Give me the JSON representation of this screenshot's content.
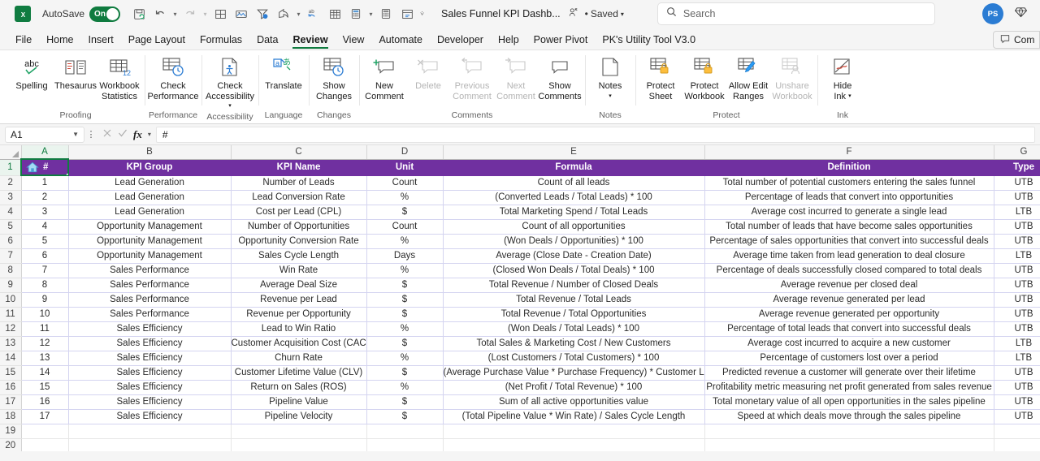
{
  "titlebar": {
    "app_logo": "excel-logo",
    "autosave_label": "AutoSave",
    "autosave_state": "On",
    "doc_title": "Sales Funnel KPI Dashb...",
    "saved_label": "Saved",
    "search_placeholder": "Search",
    "avatar_initials": "PS",
    "qat_icons": [
      "save-icon",
      "undo-icon",
      "redo-icon",
      "borders-icon",
      "picture-icon",
      "filter-icon",
      "share-icon",
      "sort-icon",
      "table-icon",
      "calculator-icon",
      "calculator2-icon",
      "form-icon",
      "more-icon"
    ]
  },
  "tabs": [
    {
      "label": "File",
      "active": false
    },
    {
      "label": "Home",
      "active": false
    },
    {
      "label": "Insert",
      "active": false
    },
    {
      "label": "Page Layout",
      "active": false
    },
    {
      "label": "Formulas",
      "active": false
    },
    {
      "label": "Data",
      "active": false
    },
    {
      "label": "Review",
      "active": true
    },
    {
      "label": "View",
      "active": false
    },
    {
      "label": "Automate",
      "active": false
    },
    {
      "label": "Developer",
      "active": false
    },
    {
      "label": "Help",
      "active": false
    },
    {
      "label": "Power Pivot",
      "active": false
    },
    {
      "label": "PK's Utility Tool V3.0",
      "active": false
    }
  ],
  "comments_button_label": "Com",
  "ribbon": {
    "groups": [
      {
        "name": "Proofing",
        "items": [
          {
            "label": "Spelling",
            "icon": "spelling-abc-icon",
            "disabled": false
          },
          {
            "label": "Thesaurus",
            "icon": "thesaurus-book-icon",
            "disabled": false
          },
          {
            "label": "Workbook\nStatistics",
            "icon": "workbook-statistics-icon",
            "disabled": false
          }
        ]
      },
      {
        "name": "Performance",
        "items": [
          {
            "label": "Check\nPerformance",
            "icon": "check-performance-icon",
            "disabled": false
          }
        ]
      },
      {
        "name": "Accessibility",
        "items": [
          {
            "label": "Check\nAccessibility",
            "icon": "check-accessibility-icon",
            "disabled": false,
            "caret": true
          }
        ]
      },
      {
        "name": "Language",
        "items": [
          {
            "label": "Translate",
            "icon": "translate-icon",
            "disabled": false
          }
        ]
      },
      {
        "name": "Changes",
        "items": [
          {
            "label": "Show\nChanges",
            "icon": "show-changes-icon",
            "disabled": false
          }
        ]
      },
      {
        "name": "Comments",
        "items": [
          {
            "label": "New\nComment",
            "icon": "new-comment-icon",
            "disabled": false
          },
          {
            "label": "Delete",
            "icon": "delete-comment-icon",
            "disabled": true
          },
          {
            "label": "Previous\nComment",
            "icon": "previous-comment-icon",
            "disabled": true
          },
          {
            "label": "Next\nComment",
            "icon": "next-comment-icon",
            "disabled": true
          },
          {
            "label": "Show\nComments",
            "icon": "show-comments-icon",
            "disabled": false
          }
        ]
      },
      {
        "name": "Notes",
        "items": [
          {
            "label": "Notes",
            "icon": "notes-icon",
            "disabled": false,
            "caret": true
          }
        ]
      },
      {
        "name": "Protect",
        "items": [
          {
            "label": "Protect\nSheet",
            "icon": "protect-sheet-icon",
            "disabled": false
          },
          {
            "label": "Protect\nWorkbook",
            "icon": "protect-workbook-icon",
            "disabled": false
          },
          {
            "label": "Allow Edit\nRanges",
            "icon": "allow-edit-ranges-icon",
            "disabled": false
          },
          {
            "label": "Unshare\nWorkbook",
            "icon": "unshare-workbook-icon",
            "disabled": true
          }
        ]
      },
      {
        "name": "Ink",
        "items": [
          {
            "label": "Hide\nInk",
            "icon": "hide-ink-icon",
            "disabled": false,
            "caret": true
          }
        ]
      }
    ]
  },
  "formula_bar": {
    "name_box": "A1",
    "cancel_icon": "cancel-icon",
    "enter_icon": "enter-icon",
    "fx_icon": "fx-icon",
    "content": "#"
  },
  "sheet": {
    "column_letters": [
      "A",
      "B",
      "C",
      "D",
      "E",
      "F",
      "G"
    ],
    "selected_cell": "A1",
    "a1_icon": "home-icon",
    "headers": [
      "#",
      "KPI Group",
      "KPI Name",
      "Unit",
      "Formula",
      "Definition",
      "Type"
    ],
    "header_bg": "#7030a0",
    "rows": [
      {
        "n": "1",
        "group": "Lead Generation",
        "kpi": "Number of Leads",
        "unit": "Count",
        "formula": "Count of all leads",
        "definition": "Total number of potential customers entering the sales funnel",
        "type": "UTB"
      },
      {
        "n": "2",
        "group": "Lead Generation",
        "kpi": "Lead Conversion Rate",
        "unit": "%",
        "formula": "(Converted Leads / Total Leads) * 100",
        "definition": "Percentage of leads that convert into opportunities",
        "type": "UTB"
      },
      {
        "n": "3",
        "group": "Lead Generation",
        "kpi": "Cost per Lead (CPL)",
        "unit": "$",
        "formula": "Total Marketing Spend / Total Leads",
        "definition": "Average cost incurred to generate a single lead",
        "type": "LTB"
      },
      {
        "n": "4",
        "group": "Opportunity Management",
        "kpi": "Number of Opportunities",
        "unit": "Count",
        "formula": "Count of all opportunities",
        "definition": "Total number of leads that have become sales opportunities",
        "type": "UTB"
      },
      {
        "n": "5",
        "group": "Opportunity Management",
        "kpi": "Opportunity Conversion Rate",
        "unit": "%",
        "formula": "(Won Deals / Opportunities) * 100",
        "definition": "Percentage of sales opportunities that convert into successful deals",
        "type": "UTB"
      },
      {
        "n": "6",
        "group": "Opportunity Management",
        "kpi": "Sales Cycle Length",
        "unit": "Days",
        "formula": "Average (Close Date - Creation Date)",
        "definition": "Average time taken from lead generation to deal closure",
        "type": "LTB"
      },
      {
        "n": "7",
        "group": "Sales Performance",
        "kpi": "Win Rate",
        "unit": "%",
        "formula": "(Closed Won Deals / Total Deals) * 100",
        "definition": "Percentage of deals successfully closed compared to total deals",
        "type": "UTB"
      },
      {
        "n": "8",
        "group": "Sales Performance",
        "kpi": "Average Deal Size",
        "unit": "$",
        "formula": "Total Revenue / Number of Closed Deals",
        "definition": "Average revenue per closed deal",
        "type": "UTB"
      },
      {
        "n": "9",
        "group": "Sales Performance",
        "kpi": "Revenue per Lead",
        "unit": "$",
        "formula": "Total Revenue / Total Leads",
        "definition": "Average revenue generated per lead",
        "type": "UTB"
      },
      {
        "n": "10",
        "group": "Sales Performance",
        "kpi": "Revenue per Opportunity",
        "unit": "$",
        "formula": "Total Revenue / Total Opportunities",
        "definition": "Average revenue generated per opportunity",
        "type": "UTB"
      },
      {
        "n": "11",
        "group": "Sales Efficiency",
        "kpi": "Lead to Win Ratio",
        "unit": "%",
        "formula": "(Won Deals / Total Leads) * 100",
        "definition": "Percentage of total leads that convert into successful deals",
        "type": "UTB"
      },
      {
        "n": "12",
        "group": "Sales Efficiency",
        "kpi": "Customer Acquisition Cost (CAC)",
        "unit": "$",
        "formula": "Total Sales & Marketing Cost / New Customers",
        "definition": "Average cost incurred to acquire a new customer",
        "type": "LTB"
      },
      {
        "n": "13",
        "group": "Sales Efficiency",
        "kpi": "Churn Rate",
        "unit": "%",
        "formula": "(Lost Customers / Total Customers) * 100",
        "definition": "Percentage of customers lost over a period",
        "type": "LTB"
      },
      {
        "n": "14",
        "group": "Sales Efficiency",
        "kpi": "Customer Lifetime Value (CLV)",
        "unit": "$",
        "formula": "(Average Purchase Value * Purchase Frequency) * Customer Lifespan",
        "definition": "Predicted revenue a customer will generate over their lifetime",
        "type": "UTB"
      },
      {
        "n": "15",
        "group": "Sales Efficiency",
        "kpi": "Return on Sales (ROS)",
        "unit": "%",
        "formula": "(Net Profit / Total Revenue) * 100",
        "definition": "Profitability metric measuring net profit generated from sales revenue",
        "type": "UTB"
      },
      {
        "n": "16",
        "group": "Sales Efficiency",
        "kpi": "Pipeline Value",
        "unit": "$",
        "formula": "Sum of all active opportunities value",
        "definition": "Total monetary value of all open opportunities in the sales pipeline",
        "type": "UTB"
      },
      {
        "n": "17",
        "group": "Sales Efficiency",
        "kpi": "Pipeline Velocity",
        "unit": "$",
        "formula": "(Total Pipeline Value * Win Rate) / Sales Cycle Length",
        "definition": "Speed at which deals move through the sales pipeline",
        "type": "UTB"
      }
    ],
    "row_numbers_visible": [
      "1",
      "2",
      "3",
      "4",
      "5",
      "6",
      "7",
      "8",
      "9",
      "10",
      "11",
      "12",
      "13",
      "14",
      "15",
      "16",
      "17",
      "18",
      "19",
      "20"
    ]
  }
}
